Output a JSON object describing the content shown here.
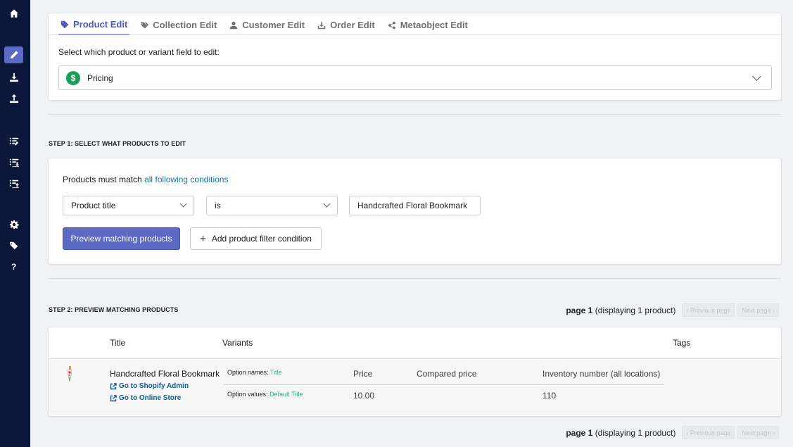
{
  "sidebar": {
    "items": [
      {
        "icon": "home-icon"
      },
      {
        "icon": "pencil-icon",
        "active": true
      },
      {
        "icon": "download-icon"
      },
      {
        "icon": "upload-icon"
      },
      {
        "icon": "list-edit-icon"
      },
      {
        "icon": "list-download-icon"
      },
      {
        "icon": "list-upload-icon"
      },
      {
        "icon": "gear-icon"
      },
      {
        "icon": "tags-icon"
      },
      {
        "icon": "help-icon",
        "text": "?"
      }
    ]
  },
  "tabs": [
    {
      "label": "Product Edit",
      "icon": "tag-icon",
      "active": true
    },
    {
      "label": "Collection Edit",
      "icon": "tags-icon"
    },
    {
      "label": "Customer Edit",
      "icon": "user-icon"
    },
    {
      "label": "Order Edit",
      "icon": "download-box-icon"
    },
    {
      "label": "Metaobject Edit",
      "icon": "share-icon"
    }
  ],
  "field_select": {
    "prompt": "Select which product or variant field to edit:",
    "value": "Pricing",
    "icon_glyph": "$"
  },
  "step1": {
    "heading": "STEP 1: SELECT WHAT PRODUCTS TO EDIT",
    "match_prefix": "Products must match",
    "match_link": "all following conditions",
    "condition": {
      "field": "Product title",
      "operator": "is",
      "value": "Handcrafted Floral Bookmark"
    },
    "preview_button": "Preview matching products",
    "add_condition_button": "Add product filter condition"
  },
  "step2": {
    "heading": "STEP 2: PREVIEW MATCHING PRODUCTS",
    "pager": {
      "page_label": "page 1",
      "display_text": "(displaying 1 product)",
      "prev": "Previous page",
      "next": "Next page"
    },
    "columns": {
      "title": "Title",
      "variants": "Variants",
      "tags": "Tags"
    },
    "products": [
      {
        "title": "Handcrafted Floral Bookmark",
        "link_admin": "Go to Shopify Admin",
        "link_store": "Go to Online Store",
        "option_names_label": "Option names:",
        "option_names_value": "Title",
        "option_values_label": "Option values:",
        "option_values_value": "Default Title",
        "headers": {
          "price": "Price",
          "compared_price": "Compared price",
          "inventory": "Inventory number (all locations)"
        },
        "price": "10.00",
        "compared_price": "",
        "inventory": "110"
      }
    ]
  },
  "colors": {
    "sidebar_bg": "#0b1739",
    "accent": "#5c6ac4",
    "link": "#0c76a9",
    "pricing_badge": "#1e9e55"
  }
}
